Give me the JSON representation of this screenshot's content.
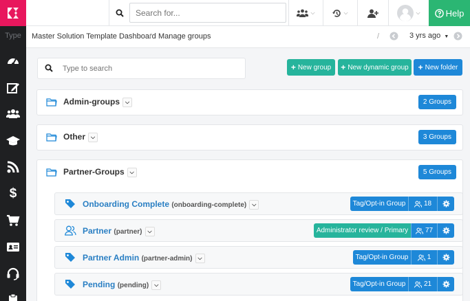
{
  "sidebar": {
    "type_label": "Type",
    "items": [
      {
        "icon": "dashboard-icon"
      },
      {
        "icon": "edit-icon"
      },
      {
        "icon": "users-icon"
      },
      {
        "icon": "graduation-cap-icon"
      },
      {
        "icon": "rss-icon"
      },
      {
        "icon": "dollar-icon"
      },
      {
        "icon": "cart-icon"
      },
      {
        "icon": "id-card-icon"
      },
      {
        "icon": "headset-icon"
      },
      {
        "icon": "clipboard-icon"
      }
    ]
  },
  "topbar": {
    "search_placeholder": "Search for...",
    "help_label": "Help"
  },
  "breadcrumb": {
    "root": "Master Solution Template Dashboard",
    "separator": "/",
    "current": "Manage groups",
    "pager_sep": "/",
    "time_label": "3 yrs ago"
  },
  "toolbar": {
    "search_placeholder": "Type to search",
    "new_group": "New group",
    "new_dynamic_group": "New dynamic group",
    "new_folder": "New folder"
  },
  "folders": [
    {
      "name": "Admin-groups",
      "count": "2 Groups"
    },
    {
      "name": "Other",
      "count": "3 Groups"
    },
    {
      "name": "Partner-Groups",
      "count": "5 Groups"
    }
  ],
  "groups": [
    {
      "name": "Onboarding Complete",
      "slug": "(onboarding-complete)",
      "type": "Tag/Opt-in Group",
      "members": "18",
      "icon": "tag-icon"
    },
    {
      "name": "Partner",
      "slug": "(partner)",
      "type": "Administrator review / Primary",
      "members": "77",
      "icon": "users-outline-icon"
    },
    {
      "name": "Partner Admin",
      "slug": "(partner-admin)",
      "type": "Tag/Opt-in Group",
      "members": "1",
      "icon": "tag-icon"
    },
    {
      "name": "Pending",
      "slug": "(pending)",
      "type": "Tag/Opt-in Group",
      "members": "21",
      "icon": "tag-icon"
    }
  ],
  "colors": {
    "brand": "#e8175d",
    "help": "#2bb673",
    "teal": "#26b49c",
    "blue": "#1e88d8",
    "link": "#2a7fc3"
  }
}
